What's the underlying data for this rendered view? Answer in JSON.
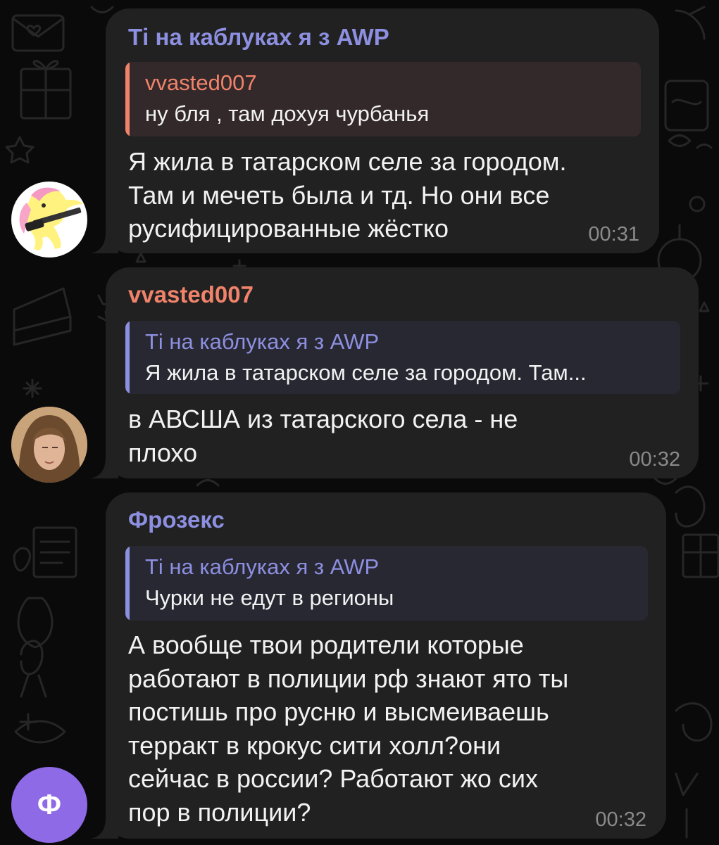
{
  "colors": {
    "background": "#0a0a0a",
    "bubble": "#212121",
    "purple_name": "#8d8fe0",
    "orange_name": "#f0836a",
    "purple_quote_bg": "#282833",
    "orange_quote_bg": "#33292a",
    "timestamp": "#8a8a8a",
    "avatar_letter_bg": "#8e6ae6"
  },
  "messages": [
    {
      "sender": "Ті на каблуках я з AWP",
      "reply": {
        "name": "vvasted007",
        "text": "ну бля , там дохуя чурбанья"
      },
      "text": "Я жила в татарском селе за городом.\nТам и мечеть была и тд. Но они все\nрусифицированные жёстко",
      "time": "00:31",
      "avatar": "pony-avatar"
    },
    {
      "sender": "vvasted007",
      "reply": {
        "name": "Ті на каблуках я з AWP",
        "text": "Я жила в татарском селе за городом. Там..."
      },
      "text": "в АВСША из татарского села - не\nплохо",
      "time": "00:32",
      "avatar": "photo-avatar"
    },
    {
      "sender": "Фрозекс",
      "reply": {
        "name": "Ті на каблуках я з AWP",
        "text": "Чурки не едут в регионы"
      },
      "text": "А вообще твои родители которые\nработают в полиции рф знают ято ты\nпостишь про русню и высмеиваешь\nтерракт в крокус сити холл?они\nсейчас в россии? Работают жо сих\nпор в полиции?",
      "time": "00:32",
      "avatar_letter": "Ф"
    }
  ]
}
